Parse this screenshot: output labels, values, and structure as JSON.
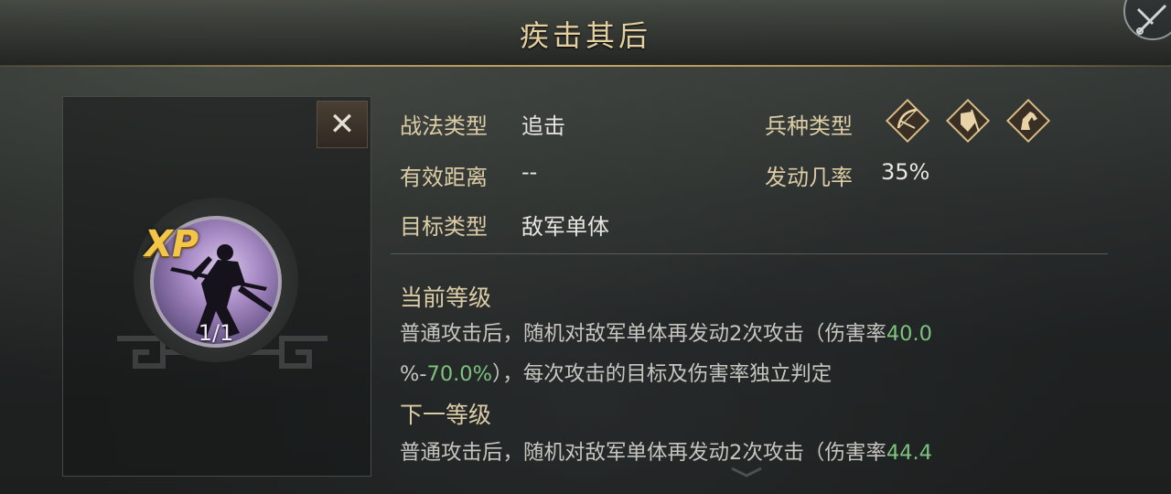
{
  "header": {
    "title": "疾击其后",
    "corner_icon": "crossed-swords-icon"
  },
  "skill_card": {
    "close_label": "✕",
    "badge_text": "XP",
    "level": "1/1",
    "portrait_icon": "warrior-silhouette-icon"
  },
  "info": {
    "tactic_type_label": "战法类型",
    "tactic_type_value": "追击",
    "range_label": "有效距离",
    "range_value": "--",
    "target_label": "目标类型",
    "target_value": "敌军单体",
    "troop_type_label": "兵种类型",
    "troop_icons": [
      "bow-archer-icon",
      "shield-infantry-icon",
      "horse-cavalry-icon"
    ],
    "trigger_label": "发动几率",
    "trigger_value": "35%"
  },
  "current_level": {
    "title": "当前等级",
    "line1_text": "普通攻击后，随机对敌军单体再发动2次攻击（伤害率",
    "line1_value": "40.0",
    "line2_prefix": "%-",
    "line2_value": "70.0%",
    "line2_text": "），每次攻击的目标及伤害率独立判定"
  },
  "next_level": {
    "title": "下一等级",
    "line1_text": "普通攻击后，随机对敌军单体再发动2次攻击（伤害率",
    "line1_value": "44.4"
  },
  "colors": {
    "label_gold": "#dccca6",
    "highlight_green": "#7dc27d",
    "xp_gold": "#f3c64a"
  }
}
